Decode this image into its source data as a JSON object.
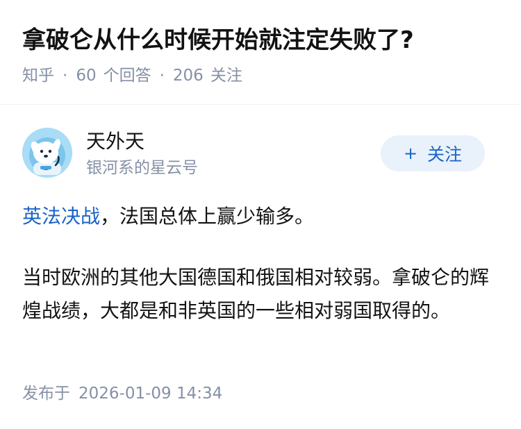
{
  "question": {
    "title": "拿破仑从什么时候开始就注定失败了?",
    "source": "知乎",
    "separator": "·",
    "answers_count": "60",
    "answers_label": "个回答",
    "followers_count": "206",
    "followers_label": "关注"
  },
  "author": {
    "avatar_icon": "dog-avatar-icon",
    "name": "天外天",
    "bio": "银河系的星云号",
    "follow_button": {
      "plus": "+",
      "label": "关注"
    }
  },
  "answer": {
    "paragraph1": {
      "link_text": "英法决战",
      "rest": "，法国总体上赢少输多。"
    },
    "paragraph2": "当时欧洲的其他大国德国和俄国相对较弱。拿破仑的辉煌战绩，大都是和非英国的一些相对弱国取得的。"
  },
  "publish": {
    "label": "发布于",
    "datetime": "2026-01-09 14:34"
  },
  "colors": {
    "title": "#121212",
    "meta": "#8590a6",
    "link": "#1a64c7",
    "follow_bg": "#e9f1fb"
  }
}
